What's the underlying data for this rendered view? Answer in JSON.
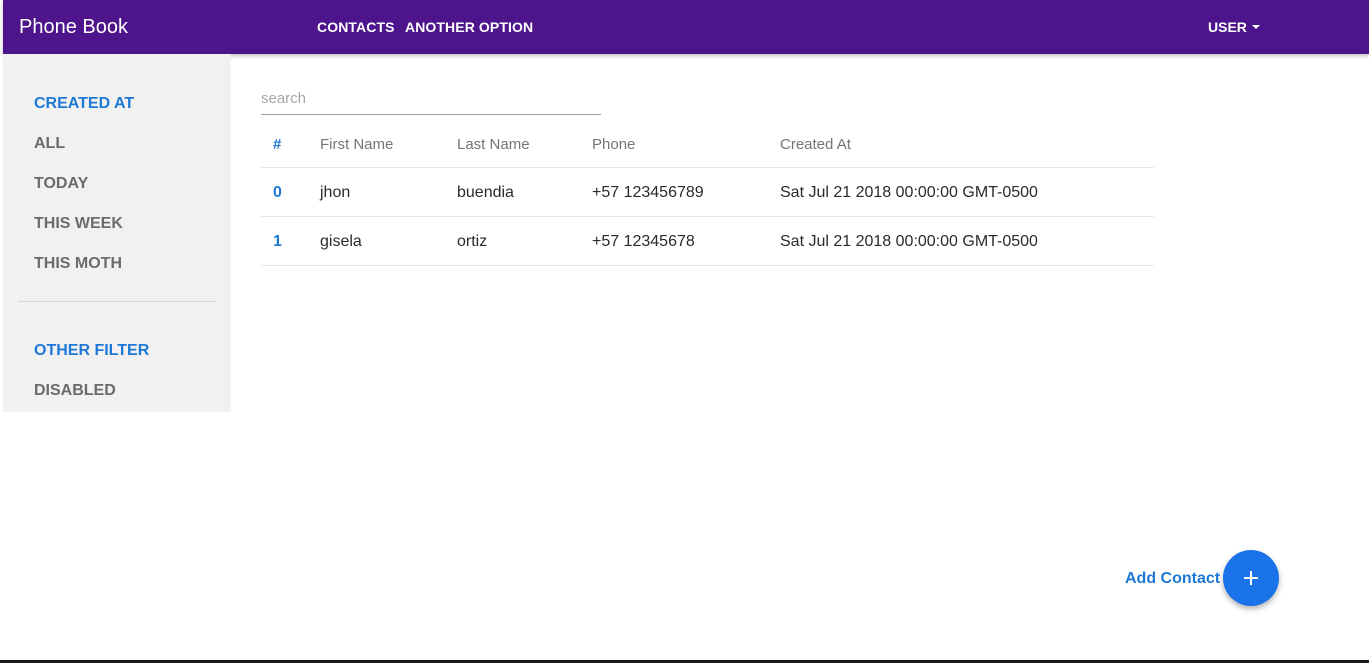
{
  "app": {
    "title": "Phone Book"
  },
  "nav": {
    "items": [
      "CONTACTS",
      "ANOTHER OPTION"
    ],
    "user_label": "USER"
  },
  "sidebar": {
    "created_at_header": "CREATED AT",
    "created_at_items": [
      "ALL",
      "TODAY",
      "THIS WEEK",
      "THIS MOTH"
    ],
    "other_filter_header": "OTHER FILTER",
    "other_filter_items": [
      "DISABLED"
    ]
  },
  "search": {
    "placeholder": "search",
    "value": ""
  },
  "table": {
    "headers": [
      "#",
      "First Name",
      "Last Name",
      "Phone",
      "Created At"
    ],
    "rows": [
      {
        "id": "0",
        "first_name": "jhon",
        "last_name": "buendia",
        "phone": "+57 123456789",
        "created_at": "Sat Jul 21 2018 00:00:00 GMT-0500"
      },
      {
        "id": "1",
        "first_name": "gisela",
        "last_name": "ortiz",
        "phone": "+57 12345678",
        "created_at": "Sat Jul 21 2018 00:00:00 GMT-0500"
      }
    ]
  },
  "actions": {
    "add_contact_label": "Add Contact",
    "add_icon": "plus-icon"
  },
  "colors": {
    "topbar": "#4d148c",
    "accent": "#1e78d6",
    "fab": "#1a73e8",
    "sidebar_bg": "#f1f1f1"
  }
}
